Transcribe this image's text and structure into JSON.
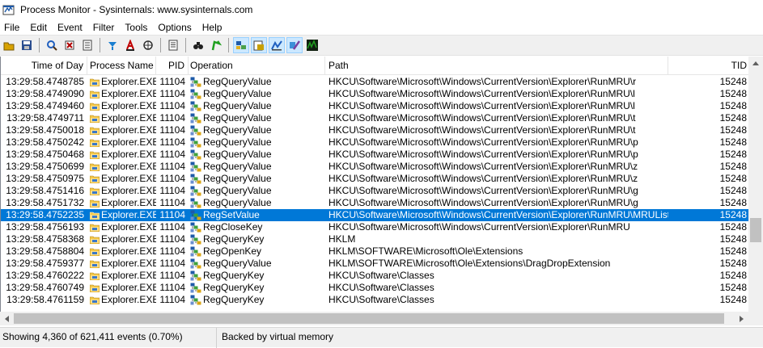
{
  "window": {
    "title": "Process Monitor - Sysinternals: www.sysinternals.com"
  },
  "menu": [
    "File",
    "Edit",
    "Event",
    "Filter",
    "Tools",
    "Options",
    "Help"
  ],
  "toolbar": {
    "buttons": [
      {
        "name": "open-icon",
        "color": "#d8a200"
      },
      {
        "name": "save-icon",
        "color": "#2a4d8f"
      },
      {
        "sep": true
      },
      {
        "name": "magnifier-icon",
        "color": "#1f5fbf"
      },
      {
        "name": "capture-icon",
        "color": "#b00000"
      },
      {
        "name": "autoscroll-icon",
        "color": "#404040"
      },
      {
        "sep": true
      },
      {
        "name": "clear-icon",
        "color": "#1a7fd0"
      },
      {
        "name": "filter-icon",
        "color": "#c00000"
      },
      {
        "name": "highlight-icon",
        "color": "#303030"
      },
      {
        "sep": true
      },
      {
        "name": "process-tree-icon",
        "color": "#404040"
      },
      {
        "sep": true
      },
      {
        "name": "find-icon",
        "color": "#202020"
      },
      {
        "name": "jump-icon",
        "color": "#1ea01e"
      },
      {
        "sep": true
      },
      {
        "name": "registry-activity-icon",
        "color": "#1e5aa8",
        "pressed": true
      },
      {
        "name": "filesystem-activity-icon",
        "color": "#c8a000",
        "pressed": true
      },
      {
        "name": "network-activity-icon",
        "color": "#2060c0",
        "pressed": true
      },
      {
        "name": "process-activity-icon",
        "color": "#7a3fa0",
        "pressed": true
      },
      {
        "name": "profiling-activity-icon",
        "color": "#20a020"
      }
    ]
  },
  "columns": {
    "time": "Time of Day",
    "process": "Process Name",
    "pid": "PID",
    "operation": "Operation",
    "path": "Path",
    "tid": "TID"
  },
  "rows": [
    {
      "time": "13:29:58.4748785",
      "process": "Explorer.EXE",
      "pid": "11104",
      "operation": "RegQueryValue",
      "path": "HKCU\\Software\\Microsoft\\Windows\\CurrentVersion\\Explorer\\RunMRU\\r",
      "tid": "15248"
    },
    {
      "time": "13:29:58.4749090",
      "process": "Explorer.EXE",
      "pid": "11104",
      "operation": "RegQueryValue",
      "path": "HKCU\\Software\\Microsoft\\Windows\\CurrentVersion\\Explorer\\RunMRU\\l",
      "tid": "15248"
    },
    {
      "time": "13:29:58.4749460",
      "process": "Explorer.EXE",
      "pid": "11104",
      "operation": "RegQueryValue",
      "path": "HKCU\\Software\\Microsoft\\Windows\\CurrentVersion\\Explorer\\RunMRU\\l",
      "tid": "15248"
    },
    {
      "time": "13:29:58.4749711",
      "process": "Explorer.EXE",
      "pid": "11104",
      "operation": "RegQueryValue",
      "path": "HKCU\\Software\\Microsoft\\Windows\\CurrentVersion\\Explorer\\RunMRU\\t",
      "tid": "15248"
    },
    {
      "time": "13:29:58.4750018",
      "process": "Explorer.EXE",
      "pid": "11104",
      "operation": "RegQueryValue",
      "path": "HKCU\\Software\\Microsoft\\Windows\\CurrentVersion\\Explorer\\RunMRU\\t",
      "tid": "15248"
    },
    {
      "time": "13:29:58.4750242",
      "process": "Explorer.EXE",
      "pid": "11104",
      "operation": "RegQueryValue",
      "path": "HKCU\\Software\\Microsoft\\Windows\\CurrentVersion\\Explorer\\RunMRU\\p",
      "tid": "15248"
    },
    {
      "time": "13:29:58.4750468",
      "process": "Explorer.EXE",
      "pid": "11104",
      "operation": "RegQueryValue",
      "path": "HKCU\\Software\\Microsoft\\Windows\\CurrentVersion\\Explorer\\RunMRU\\p",
      "tid": "15248"
    },
    {
      "time": "13:29:58.4750699",
      "process": "Explorer.EXE",
      "pid": "11104",
      "operation": "RegQueryValue",
      "path": "HKCU\\Software\\Microsoft\\Windows\\CurrentVersion\\Explorer\\RunMRU\\z",
      "tid": "15248"
    },
    {
      "time": "13:29:58.4750975",
      "process": "Explorer.EXE",
      "pid": "11104",
      "operation": "RegQueryValue",
      "path": "HKCU\\Software\\Microsoft\\Windows\\CurrentVersion\\Explorer\\RunMRU\\z",
      "tid": "15248"
    },
    {
      "time": "13:29:58.4751416",
      "process": "Explorer.EXE",
      "pid": "11104",
      "operation": "RegQueryValue",
      "path": "HKCU\\Software\\Microsoft\\Windows\\CurrentVersion\\Explorer\\RunMRU\\g",
      "tid": "15248"
    },
    {
      "time": "13:29:58.4751732",
      "process": "Explorer.EXE",
      "pid": "11104",
      "operation": "RegQueryValue",
      "path": "HKCU\\Software\\Microsoft\\Windows\\CurrentVersion\\Explorer\\RunMRU\\g",
      "tid": "15248"
    },
    {
      "time": "13:29:58.4752235",
      "process": "Explorer.EXE",
      "pid": "11104",
      "operation": "RegSetValue",
      "path": "HKCU\\Software\\Microsoft\\Windows\\CurrentVersion\\Explorer\\RunMRU\\MRUList",
      "tid": "15248",
      "selected": true
    },
    {
      "time": "13:29:58.4756193",
      "process": "Explorer.EXE",
      "pid": "11104",
      "operation": "RegCloseKey",
      "path": "HKCU\\Software\\Microsoft\\Windows\\CurrentVersion\\Explorer\\RunMRU",
      "tid": "15248"
    },
    {
      "time": "13:29:58.4758368",
      "process": "Explorer.EXE",
      "pid": "11104",
      "operation": "RegQueryKey",
      "path": "HKLM",
      "tid": "15248"
    },
    {
      "time": "13:29:58.4758804",
      "process": "Explorer.EXE",
      "pid": "11104",
      "operation": "RegOpenKey",
      "path": "HKLM\\SOFTWARE\\Microsoft\\Ole\\Extensions",
      "tid": "15248"
    },
    {
      "time": "13:29:58.4759377",
      "process": "Explorer.EXE",
      "pid": "11104",
      "operation": "RegQueryValue",
      "path": "HKLM\\SOFTWARE\\Microsoft\\Ole\\Extensions\\DragDropExtension",
      "tid": "15248"
    },
    {
      "time": "13:29:58.4760222",
      "process": "Explorer.EXE",
      "pid": "11104",
      "operation": "RegQueryKey",
      "path": "HKCU\\Software\\Classes",
      "tid": "15248"
    },
    {
      "time": "13:29:58.4760749",
      "process": "Explorer.EXE",
      "pid": "11104",
      "operation": "RegQueryKey",
      "path": "HKCU\\Software\\Classes",
      "tid": "15248"
    },
    {
      "time": "13:29:58.4761159",
      "process": "Explorer.EXE",
      "pid": "11104",
      "operation": "RegQueryKey",
      "path": "HKCU\\Software\\Classes",
      "tid": "15248"
    }
  ],
  "status": {
    "events": "Showing 4,360 of 621,411 events (0.70%)",
    "memory": "Backed by virtual memory"
  },
  "colors": {
    "selection": "#0078d7",
    "folder": "#f3c84a",
    "registry": "#1e5aa8"
  }
}
